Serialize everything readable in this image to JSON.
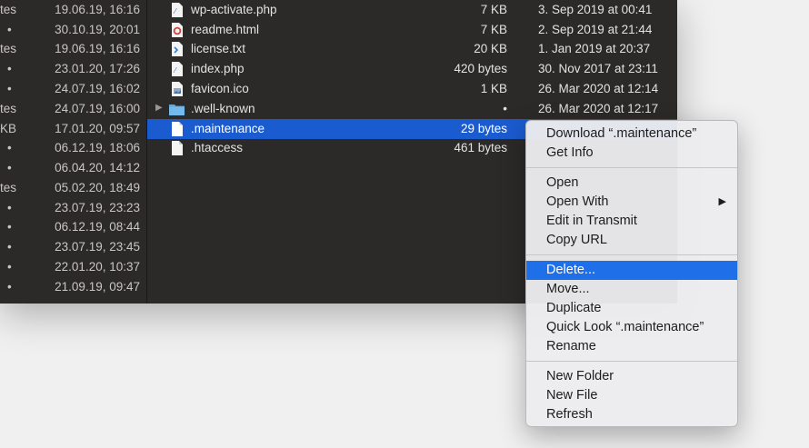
{
  "left_column": {
    "rows": [
      {
        "size": "tes",
        "date": "19.06.19, 16:16"
      },
      {
        "size": "•",
        "date": "30.10.19, 20:01"
      },
      {
        "size": "tes",
        "date": "19.06.19, 16:16"
      },
      {
        "size": "•",
        "date": "23.01.20, 17:26"
      },
      {
        "size": "•",
        "date": "24.07.19, 16:02"
      },
      {
        "size": "tes",
        "date": "24.07.19, 16:00"
      },
      {
        "size": "KB",
        "date": "17.01.20, 09:57"
      },
      {
        "size": "•",
        "date": "06.12.19, 18:06"
      },
      {
        "size": "•",
        "date": "06.04.20, 14:12"
      },
      {
        "size": "tes",
        "date": "05.02.20, 18:49"
      },
      {
        "size": "•",
        "date": "23.07.19, 23:23"
      },
      {
        "size": "•",
        "date": "06.12.19, 08:44"
      },
      {
        "size": "•",
        "date": "23.07.19, 23:45"
      },
      {
        "size": "•",
        "date": "22.01.20, 10:37"
      },
      {
        "size": "•",
        "date": "21.09.19, 09:47"
      }
    ]
  },
  "files": [
    {
      "name": "wp-activate.php",
      "size": "7 KB",
      "date": "3. Sep 2019 at 00:41",
      "icon": "php-file-icon"
    },
    {
      "name": "readme.html",
      "size": "7 KB",
      "date": "2. Sep 2019 at 21:44",
      "icon": "html-file-icon"
    },
    {
      "name": "license.txt",
      "size": "20 KB",
      "date": "1. Jan 2019 at 20:37",
      "icon": "text-file-icon"
    },
    {
      "name": "index.php",
      "size": "420 bytes",
      "date": "30. Nov 2017 at 23:11",
      "icon": "php-file-icon"
    },
    {
      "name": "favicon.ico",
      "size": "1 KB",
      "date": "26. Mar 2020 at 12:14",
      "icon": "image-file-icon"
    },
    {
      "name": ".well-known",
      "size": "•",
      "date": "26. Mar 2020 at 12:17",
      "icon": "folder-icon"
    },
    {
      "name": ".maintenance",
      "size": "29 bytes",
      "date": "",
      "icon": "blank-file-icon"
    },
    {
      "name": ".htaccess",
      "size": "461 bytes",
      "date": "",
      "icon": "blank-file-icon"
    }
  ],
  "colors": {
    "selection": "#1b5bd0",
    "menu_highlight": "#1e6fe8",
    "window_bg": "#2c2a28"
  },
  "context_menu": {
    "group1": [
      "Download “.maintenance”",
      "Get Info"
    ],
    "group2": [
      "Open",
      "Open With",
      "Edit in Transmit",
      "Copy URL"
    ],
    "group3": [
      "Delete...",
      "Move...",
      "Duplicate",
      "Quick Look “.maintenance”",
      "Rename"
    ],
    "group4": [
      "New Folder",
      "New File",
      "Refresh"
    ],
    "submenu_arrow": "▶"
  }
}
